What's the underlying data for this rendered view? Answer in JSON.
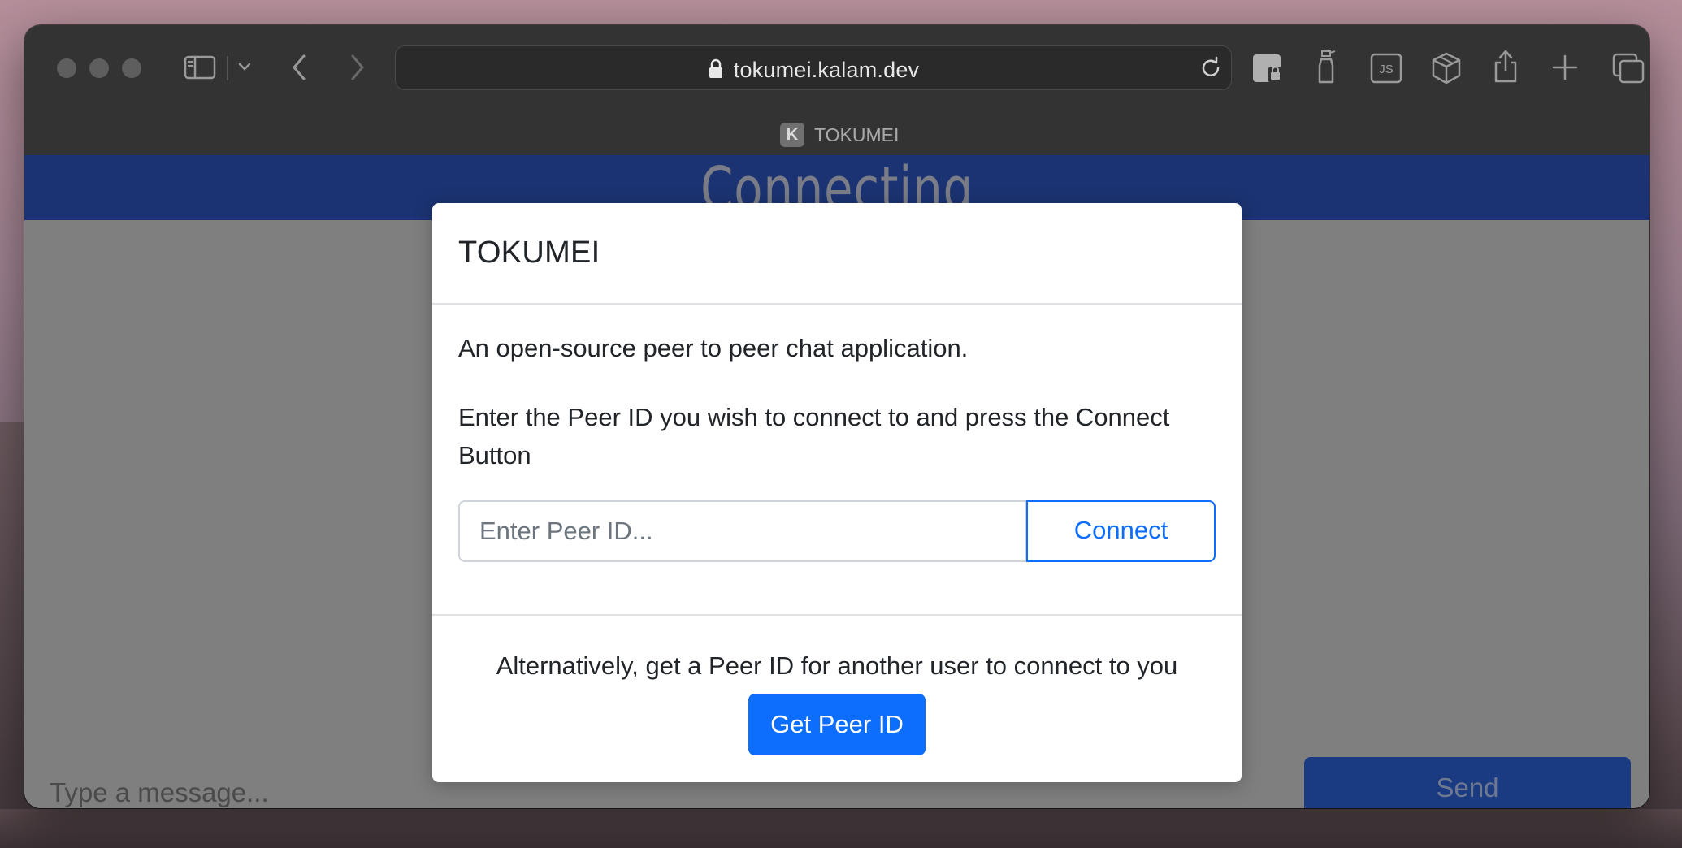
{
  "browser": {
    "url": "tokumei.kalam.dev",
    "tab_title": "TOKUMEI",
    "favicon_letter": "K",
    "extension_js_label": "JS"
  },
  "page": {
    "header_title": "Connecting",
    "message_placeholder": "Type a message...",
    "send_label": "Send"
  },
  "modal": {
    "title": "TOKUMEI",
    "description": "An open-source peer to peer chat application.",
    "instruction": "Enter the Peer ID you wish to connect to and press the Connect Button",
    "peer_input_placeholder": "Enter Peer ID...",
    "peer_input_value": "",
    "connect_label": "Connect",
    "alternative_text": "Alternatively, get a Peer ID for another user to connect to you",
    "get_peer_id_label": "Get Peer ID"
  },
  "colors": {
    "header_band": "#1b3372",
    "primary": "#0d6efd",
    "overlay": "#7f7f7f"
  },
  "icons": [
    "sidebar-icon",
    "chevron-down-icon",
    "back-icon",
    "forward-icon",
    "lock-icon",
    "reload-icon",
    "shield-extension-icon",
    "spray-bottle-icon",
    "js-extension-icon",
    "cube-icon",
    "share-icon",
    "new-tab-icon",
    "tabs-overview-icon"
  ]
}
